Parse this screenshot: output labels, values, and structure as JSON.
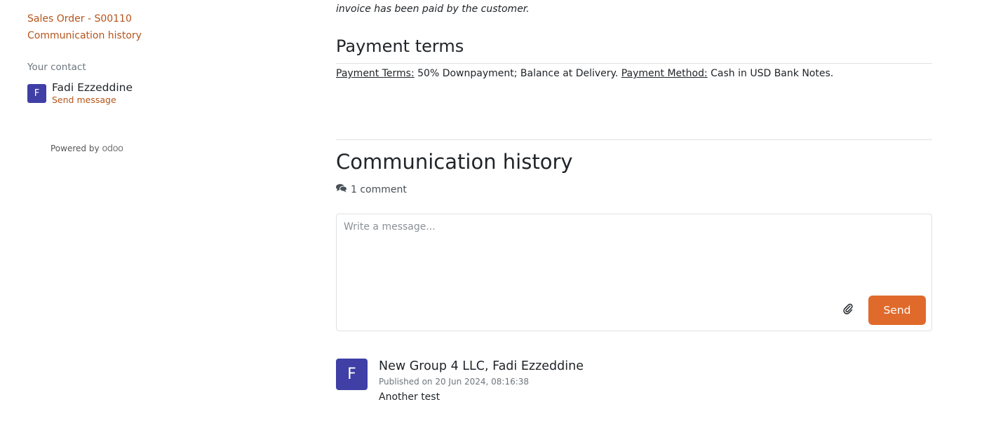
{
  "sidebar": {
    "links": [
      {
        "label": "Sales Order - S00110"
      },
      {
        "label": "Communication history"
      }
    ],
    "contact_label": "Your contact",
    "contact": {
      "initial": "F",
      "name": "Fadi Ezzeddine",
      "send_label": "Send message"
    },
    "powered_by": "Powered by",
    "logo_text": "odoo"
  },
  "main": {
    "cutoff_text": "invoice has been paid by the customer.",
    "payment_section": {
      "title": "Payment terms",
      "terms_label": "Payment Terms:",
      "terms_value": " 50% Downpayment; Balance at Delivery. ",
      "method_label": "Payment Method:",
      "method_value": " Cash in USD Bank Notes."
    },
    "communication": {
      "title": "Communication history",
      "comment_count": "1 comment",
      "composer": {
        "placeholder": "Write a message...",
        "send_label": "Send"
      },
      "messages": [
        {
          "initial": "F",
          "author": "New Group 4 LLC, Fadi Ezzeddine",
          "published": "Published on 20 Jun 2024, 08:16:38",
          "body": "Another test"
        }
      ]
    }
  },
  "colors": {
    "link": "#b5541a",
    "primary_button": "#e06a2b",
    "avatar": "#3f3fa6"
  }
}
